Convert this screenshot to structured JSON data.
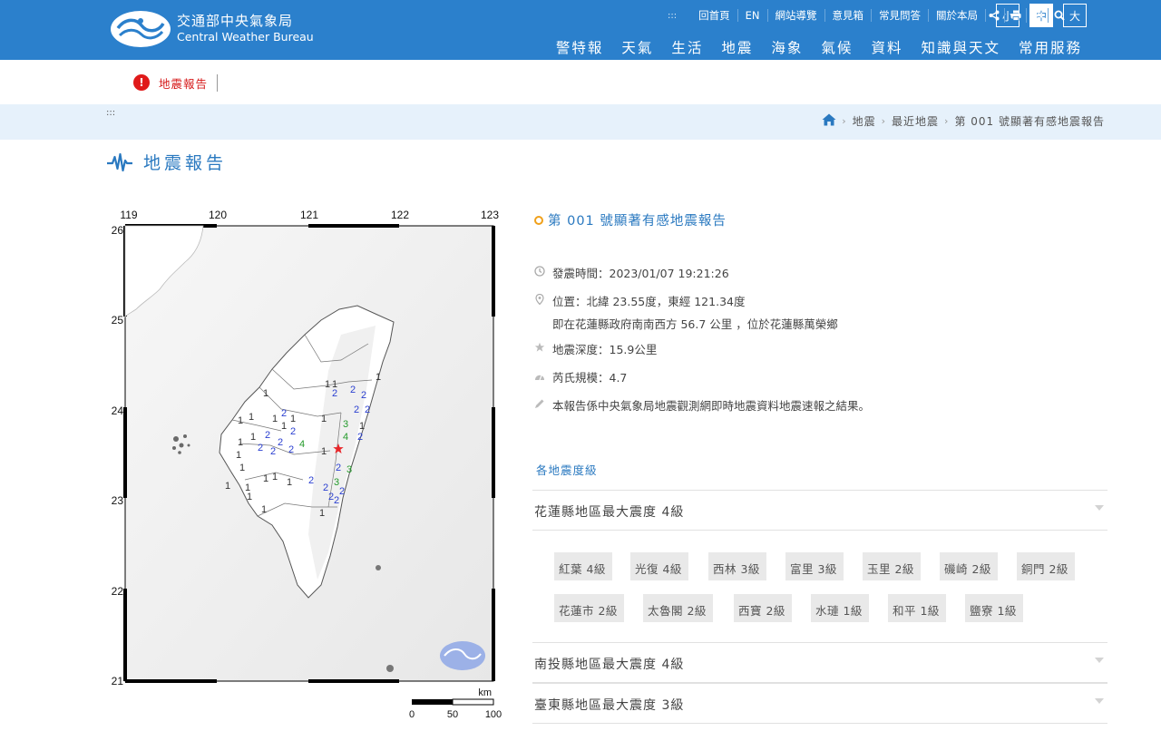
{
  "header": {
    "org_name_zh": "交通部中央氣象局",
    "org_name_en": "Central Weather Bureau",
    "top_links": [
      "回首頁",
      "EN",
      "網站導覽",
      "意見箱",
      "常見問答",
      "關於本局"
    ],
    "font_sizes": [
      "小",
      "中",
      "大"
    ],
    "font_size_active": "中",
    "icons": [
      "share-icon",
      "print-icon",
      "settings-icon",
      "search-icon"
    ],
    "main_nav": [
      "警特報",
      "天氣",
      "生活",
      "地震",
      "海象",
      "氣候",
      "資料",
      "知識與天文",
      "常用服務"
    ]
  },
  "alert": {
    "icon": "!",
    "text": "地震報告"
  },
  "breadcrumb": {
    "grip": ":::",
    "items": [
      "地震",
      "最近地震",
      "第 001 號顯著有感地震報告"
    ]
  },
  "page_title": "地震報告",
  "map": {
    "lon_ticks": [
      "119",
      "120",
      "121",
      "122",
      "123"
    ],
    "lat_ticks": [
      "26",
      "25",
      "24",
      "23",
      "22",
      "21"
    ],
    "scale_unit": "km",
    "scale_ticks": [
      "0",
      "50",
      "100"
    ],
    "epicenter_color": "#e8262a",
    "intensity_colors": {
      "1": "#333333",
      "2": "#2a3fd0",
      "3": "#239a2a",
      "4": "#239a2a"
    }
  },
  "report": {
    "title": "第 001 號顯著有感地震報告",
    "time_label": "發震時間：2023/01/07 19:21:26",
    "location_line1": "位置：北緯 23.55度，東經 121.34度",
    "location_line2": "即在花蓮縣政府南南西方 56.7 公里 ，位於花蓮縣萬榮鄉",
    "depth": "地震深度：15.9公里",
    "magnitude": "芮氏規模：4.7",
    "note": "本報告係中央氣象局地震觀測網即時地震資料地震速報之結果。"
  },
  "intensity": {
    "section_label": "各地震度級",
    "groups": [
      {
        "label": "花蓮縣地區最大震度 4級"
      },
      {
        "label": "南投縣地區最大震度 4級"
      },
      {
        "label": "臺東縣地區最大震度 3級"
      }
    ],
    "hualien_stations": [
      "紅葉 4級",
      "光復 4級",
      "西林 3級",
      "富里 3級",
      "玉里 2級",
      "磯崎 2級",
      "銅門 2級",
      "花蓮市 2級",
      "太魯閣 2級",
      "西寶 2級",
      "水璉 1級",
      "和平 1級",
      "鹽寮 1級"
    ]
  }
}
